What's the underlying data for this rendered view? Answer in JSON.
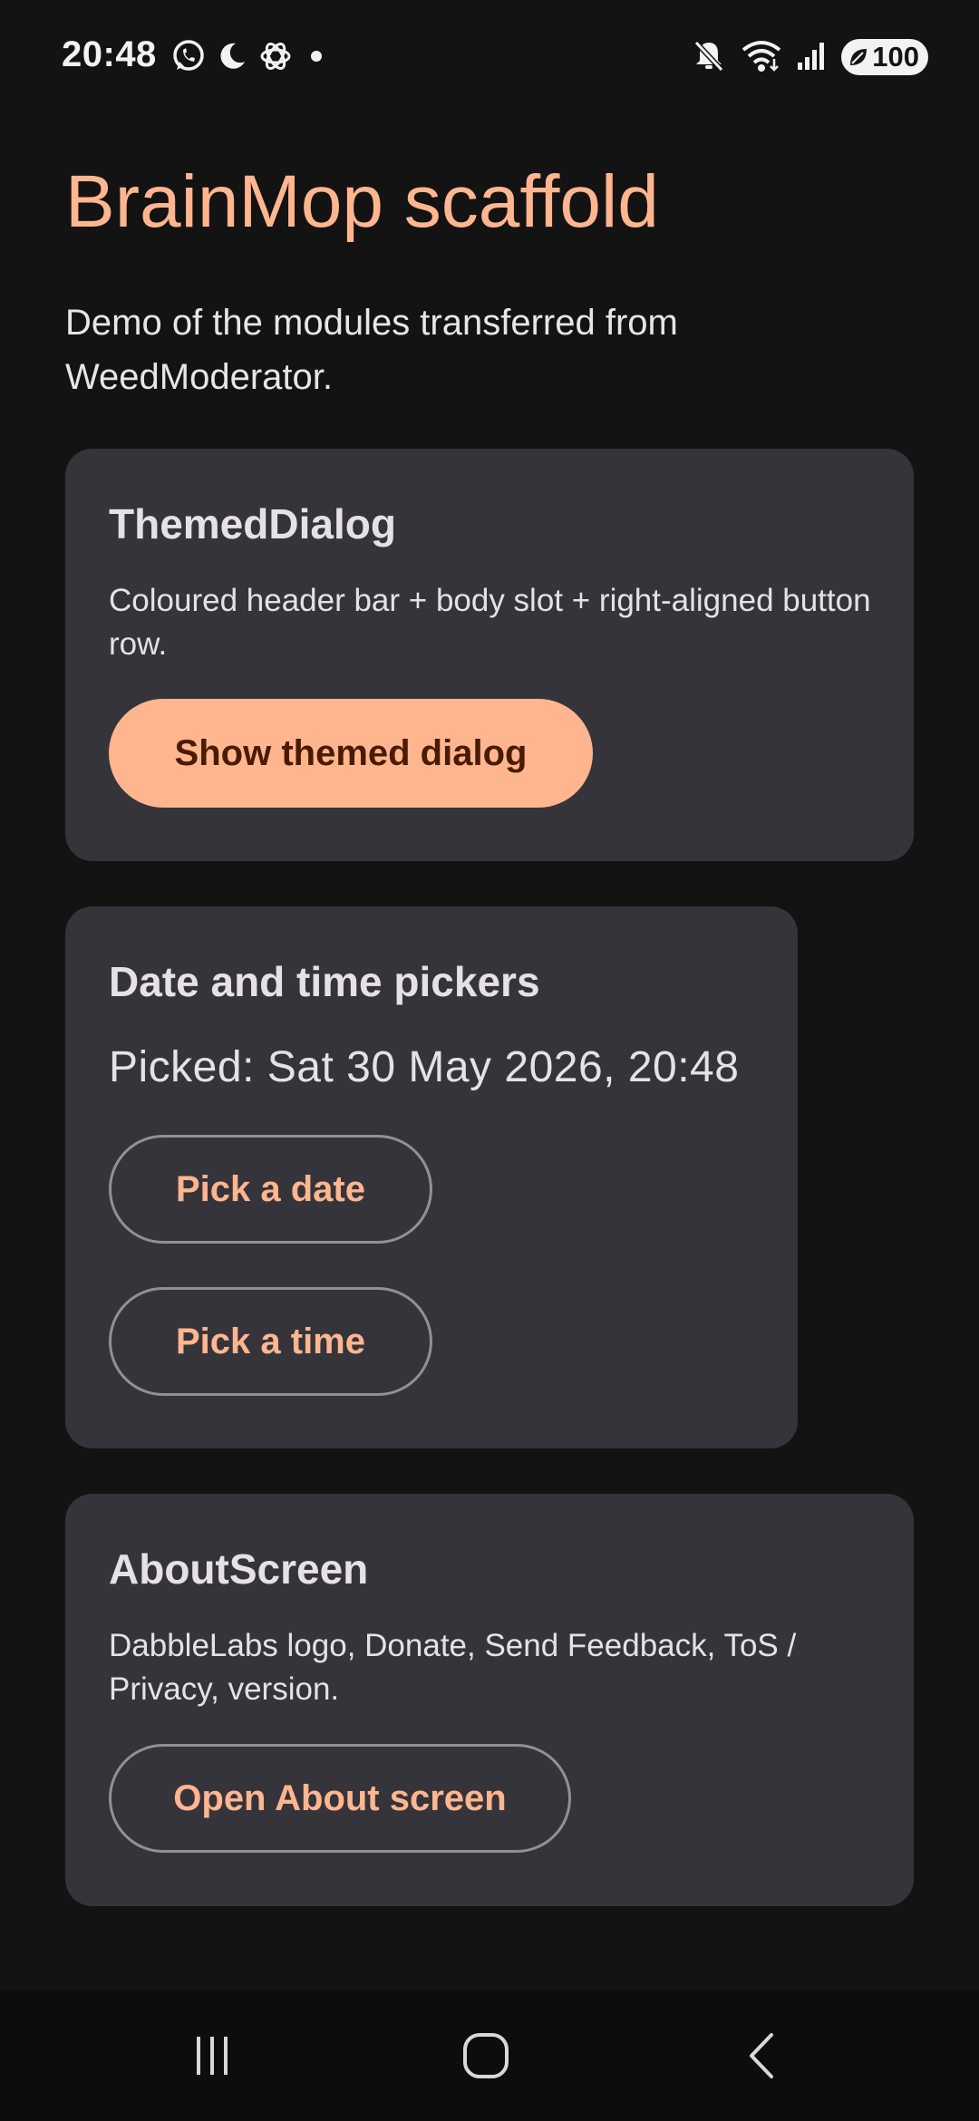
{
  "status_bar": {
    "time": "20:48",
    "battery": "100",
    "left_icons": [
      "whatsapp-icon",
      "moon-icon",
      "openai-icon",
      "dot-icon"
    ],
    "right_icons": [
      "mute-icon",
      "wifi-icon",
      "signal-icon",
      "battery-icon"
    ]
  },
  "header": {
    "title": "BrainMop scaffold",
    "subtitle": "Demo of the modules transferred from WeedModerator."
  },
  "cards": {
    "themed_dialog": {
      "title": "ThemedDialog",
      "description": "Coloured header bar + body slot + right-aligned button row.",
      "button_label": "Show themed dialog"
    },
    "pickers": {
      "title": "Date and time pickers",
      "picked": "Picked: Sat 30 May 2026, 20:48",
      "date_button_label": "Pick a date",
      "time_button_label": "Pick a time"
    },
    "about": {
      "title": "AboutScreen",
      "description": "DabbleLabs logo, Donate, Send Feedback, ToS / Privacy, version.",
      "button_label": "Open About screen"
    }
  },
  "nav_bar": {
    "icons": [
      "recent-apps-icon",
      "home-icon",
      "back-icon"
    ]
  },
  "colors": {
    "background": "#131313",
    "card": "#36343b",
    "accent": "#ffb68f",
    "on_accent": "#4a1b00",
    "text": "#e6e1e6",
    "outline": "#938f99"
  }
}
